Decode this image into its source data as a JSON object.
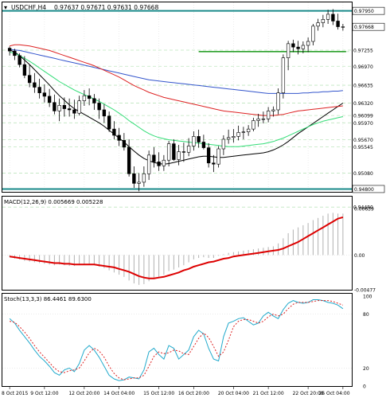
{
  "header": {
    "symbol": "USDCHF,H4",
    "quote": "0.97637 0.97671 0.97631 0.97668"
  },
  "colors": {
    "bull_candle": "#ffffff",
    "bear_candle": "#000000",
    "level_line": "#1a8a8a",
    "support_line": "#2ca02c",
    "ma_black": "#000000",
    "ma_blue": "#3355cc",
    "ma_red": "#dd2222",
    "ma_green": "#33dd77",
    "macd_signal": "#dd0000",
    "macd_hist": "#b0b0b0",
    "stoch_main": "#22aacc",
    "stoch_signal": "#dd2222",
    "grid": "#e0e0e0",
    "dashed_level": "#bfe6bf"
  },
  "chart_data": [
    {
      "type": "candlestick",
      "title": "USDCHF,H4",
      "ylim": [
        0.9475,
        0.981
      ],
      "price_ticks": [
        "0.97950",
        "0.97668",
        "0.97255",
        "0.96970",
        "0.96635",
        "0.96320",
        "0.96099",
        "0.95970",
        "0.95670",
        "0.95545",
        "0.95080",
        "0.94800",
        "0.94480"
      ],
      "highlighted_levels": [
        {
          "label": "0.97950",
          "value": 0.9795
        },
        {
          "label": "0.97668",
          "value": 0.97668
        },
        {
          "label": "0.94800",
          "value": 0.948
        }
      ],
      "support_level": 0.9723,
      "open": [
        0.9729,
        0.9724,
        0.9716,
        0.97,
        0.9681,
        0.9668,
        0.966,
        0.965,
        0.9644,
        0.9633,
        0.9618,
        0.9628,
        0.9622,
        0.962,
        0.9614,
        0.9636,
        0.9645,
        0.964,
        0.9632,
        0.962,
        0.9609,
        0.9586,
        0.9575,
        0.9566,
        0.9554,
        0.9507,
        0.949,
        0.9492,
        0.9507,
        0.954,
        0.9528,
        0.9521,
        0.9531,
        0.956,
        0.9532,
        0.9546,
        0.9545,
        0.9556,
        0.9573,
        0.9563,
        0.9553,
        0.9526,
        0.9524,
        0.9551,
        0.9568,
        0.9571,
        0.9573,
        0.958,
        0.9581,
        0.9586,
        0.9601,
        0.9604,
        0.9604,
        0.9618,
        0.962,
        0.965,
        0.9712,
        0.9737,
        0.9731,
        0.9728,
        0.9734,
        0.9741,
        0.9768,
        0.9774,
        0.978,
        0.9789,
        0.9777,
        0.9767
      ],
      "high": [
        0.9732,
        0.9728,
        0.972,
        0.9715,
        0.97,
        0.9685,
        0.9675,
        0.9665,
        0.9657,
        0.9647,
        0.964,
        0.9642,
        0.964,
        0.9638,
        0.9645,
        0.9655,
        0.9658,
        0.9648,
        0.964,
        0.963,
        0.9617,
        0.96,
        0.9588,
        0.9579,
        0.9568,
        0.952,
        0.9508,
        0.952,
        0.9548,
        0.9554,
        0.9545,
        0.954,
        0.9565,
        0.9568,
        0.9558,
        0.9562,
        0.957,
        0.9582,
        0.9585,
        0.9576,
        0.9561,
        0.954,
        0.9556,
        0.9575,
        0.9585,
        0.9586,
        0.9592,
        0.959,
        0.9593,
        0.9606,
        0.9613,
        0.9617,
        0.9625,
        0.9626,
        0.9658,
        0.9718,
        0.9742,
        0.9744,
        0.9742,
        0.9741,
        0.9748,
        0.9772,
        0.9781,
        0.9788,
        0.9797,
        0.9798,
        0.979,
        0.9772
      ],
      "low": [
        0.9716,
        0.9708,
        0.9695,
        0.9676,
        0.966,
        0.965,
        0.964,
        0.9633,
        0.9625,
        0.9612,
        0.96,
        0.9608,
        0.9608,
        0.9604,
        0.961,
        0.9627,
        0.9628,
        0.962,
        0.9604,
        0.9597,
        0.9581,
        0.9568,
        0.9556,
        0.9548,
        0.9502,
        0.9482,
        0.9476,
        0.9484,
        0.9496,
        0.9518,
        0.9512,
        0.9512,
        0.952,
        0.953,
        0.9522,
        0.9528,
        0.9538,
        0.9548,
        0.9553,
        0.955,
        0.9518,
        0.951,
        0.9518,
        0.954,
        0.956,
        0.9562,
        0.9566,
        0.9568,
        0.9574,
        0.9582,
        0.959,
        0.9596,
        0.9598,
        0.9608,
        0.9612,
        0.964,
        0.969,
        0.9722,
        0.9718,
        0.972,
        0.9722,
        0.9734,
        0.976,
        0.9766,
        0.9772,
        0.977,
        0.9762,
        0.976
      ],
      "close": [
        0.9724,
        0.9716,
        0.97,
        0.9681,
        0.9668,
        0.966,
        0.965,
        0.9644,
        0.9633,
        0.9618,
        0.9628,
        0.9622,
        0.962,
        0.9614,
        0.9636,
        0.9645,
        0.964,
        0.9632,
        0.962,
        0.9609,
        0.9586,
        0.9575,
        0.9566,
        0.9554,
        0.9507,
        0.949,
        0.9492,
        0.9507,
        0.954,
        0.9528,
        0.9521,
        0.9531,
        0.956,
        0.9532,
        0.9546,
        0.9545,
        0.9556,
        0.9573,
        0.9563,
        0.9553,
        0.9526,
        0.9524,
        0.9551,
        0.9568,
        0.9571,
        0.9573,
        0.958,
        0.9581,
        0.9586,
        0.9601,
        0.9604,
        0.9604,
        0.9618,
        0.962,
        0.965,
        0.9712,
        0.9737,
        0.9731,
        0.9728,
        0.9734,
        0.9741,
        0.9768,
        0.9774,
        0.978,
        0.9789,
        0.9777,
        0.9767,
        0.9767
      ],
      "series": [
        {
          "name": "MA black",
          "values": [
            0.9726,
            0.9722,
            0.9716,
            0.9708,
            0.97,
            0.9691,
            0.9682,
            0.9673,
            0.9664,
            0.9654,
            0.9645,
            0.9637,
            0.9629,
            0.9622,
            0.9617,
            0.9612,
            0.9607,
            0.9602,
            0.9597,
            0.9591,
            0.9584,
            0.9577,
            0.957,
            0.9563,
            0.9555,
            0.9547,
            0.954,
            0.9534,
            0.953,
            0.9527,
            0.9525,
            0.9524,
            0.9525,
            0.9527,
            0.9529,
            0.9531,
            0.9533,
            0.9535,
            0.9537,
            0.9538,
            0.9538,
            0.9537,
            0.9536,
            0.9536,
            0.9537,
            0.9538,
            0.9539,
            0.954,
            0.9541,
            0.9542,
            0.9543,
            0.9544,
            0.9546,
            0.9549,
            0.9553,
            0.9558,
            0.9564,
            0.9571,
            0.9578,
            0.9584,
            0.959,
            0.9596,
            0.9602,
            0.9608,
            0.9614,
            0.962,
            0.9626,
            0.9632
          ]
        },
        {
          "name": "MA blue",
          "values": [
            0.9727,
            0.9726,
            0.9725,
            0.9723,
            0.9721,
            0.9719,
            0.9717,
            0.9715,
            0.9713,
            0.9711,
            0.9709,
            0.9707,
            0.9705,
            0.9703,
            0.9701,
            0.9699,
            0.9697,
            0.9695,
            0.9693,
            0.9691,
            0.9689,
            0.9687,
            0.9685,
            0.9683,
            0.9681,
            0.9679,
            0.9677,
            0.9675,
            0.9673,
            0.9672,
            0.9671,
            0.967,
            0.9669,
            0.9668,
            0.9667,
            0.9666,
            0.9665,
            0.9664,
            0.9663,
            0.9662,
            0.9661,
            0.966,
            0.9659,
            0.9658,
            0.9657,
            0.9656,
            0.9655,
            0.9654,
            0.9653,
            0.9652,
            0.9651,
            0.965,
            0.9649,
            0.9649,
            0.9649,
            0.9649,
            0.9649,
            0.9649,
            0.9649,
            0.965,
            0.965,
            0.9651,
            0.9651,
            0.9652,
            0.9652,
            0.9653,
            0.9653,
            0.9654
          ]
        },
        {
          "name": "MA red",
          "values": [
            0.9733,
            0.9735,
            0.9735,
            0.9734,
            0.9733,
            0.9731,
            0.9729,
            0.9727,
            0.9725,
            0.9722,
            0.9719,
            0.9716,
            0.9713,
            0.971,
            0.9707,
            0.9704,
            0.9701,
            0.9698,
            0.9694,
            0.969,
            0.9686,
            0.9682,
            0.9678,
            0.9673,
            0.9668,
            0.9663,
            0.9659,
            0.9655,
            0.9651,
            0.9648,
            0.9645,
            0.9642,
            0.964,
            0.9638,
            0.9636,
            0.9634,
            0.9632,
            0.963,
            0.9628,
            0.9626,
            0.9624,
            0.9622,
            0.962,
            0.9618,
            0.9617,
            0.9616,
            0.9615,
            0.9614,
            0.9613,
            0.9612,
            0.9611,
            0.961,
            0.961,
            0.961,
            0.9611,
            0.9612,
            0.9614,
            0.9616,
            0.9618,
            0.9619,
            0.962,
            0.9621,
            0.9622,
            0.9623,
            0.9624,
            0.9625,
            0.9626,
            0.9627
          ]
        },
        {
          "name": "MA green",
          "values": [
            0.9722,
            0.972,
            0.9716,
            0.9711,
            0.9706,
            0.97,
            0.9694,
            0.9688,
            0.9682,
            0.9676,
            0.967,
            0.9665,
            0.966,
            0.9655,
            0.9651,
            0.9647,
            0.9643,
            0.9639,
            0.9635,
            0.963,
            0.9625,
            0.962,
            0.9614,
            0.9608,
            0.9601,
            0.9595,
            0.9589,
            0.9583,
            0.9578,
            0.9574,
            0.9571,
            0.9569,
            0.9567,
            0.9566,
            0.9565,
            0.9564,
            0.9563,
            0.9562,
            0.9561,
            0.956,
            0.9559,
            0.9558,
            0.9557,
            0.9556,
            0.9555,
            0.9555,
            0.9555,
            0.9556,
            0.9557,
            0.9558,
            0.9559,
            0.956,
            0.9562,
            0.9564,
            0.9567,
            0.957,
            0.9574,
            0.9578,
            0.9582,
            0.9586,
            0.959,
            0.9594,
            0.9597,
            0.96,
            0.9602,
            0.9604,
            0.9606,
            0.9608
          ]
        }
      ]
    },
    {
      "type": "histogram-line",
      "title": "MACD(12,26,9) 0.005669 0.005228",
      "ylim": [
        -0.00477,
        0.00639
      ],
      "ticks": [
        "0.00639",
        "0.00",
        "-0.00477"
      ],
      "hist": [
        -0.0003,
        -0.0005,
        -0.0006,
        -0.0008,
        -0.0009,
        -0.001,
        -0.0011,
        -0.0012,
        -0.0013,
        -0.0014,
        -0.0013,
        -0.0014,
        -0.0015,
        -0.0015,
        -0.0014,
        -0.0013,
        -0.0013,
        -0.0014,
        -0.0016,
        -0.0018,
        -0.0021,
        -0.0024,
        -0.0027,
        -0.003,
        -0.0035,
        -0.0039,
        -0.0041,
        -0.004,
        -0.0036,
        -0.0033,
        -0.003,
        -0.0027,
        -0.0022,
        -0.002,
        -0.0017,
        -0.0014,
        -0.001,
        -0.0006,
        -0.0004,
        -0.0003,
        -0.0004,
        -0.0004,
        -0.0001,
        0.0001,
        0.0003,
        0.0004,
        0.0005,
        0.0006,
        0.0007,
        0.0008,
        0.0009,
        0.001,
        0.0011,
        0.0012,
        0.0016,
        0.0023,
        0.003,
        0.0035,
        0.0038,
        0.0041,
        0.0044,
        0.0048,
        0.0051,
        0.0054,
        0.0057,
        0.0058,
        0.0057,
        0.0057
      ],
      "signal": [
        -0.0002,
        -0.0003,
        -0.0004,
        -0.0005,
        -0.0006,
        -0.0007,
        -0.0008,
        -0.0009,
        -0.001,
        -0.0011,
        -0.0011,
        -0.0012,
        -0.0012,
        -0.0013,
        -0.0013,
        -0.0013,
        -0.0013,
        -0.0013,
        -0.0014,
        -0.0015,
        -0.0016,
        -0.0017,
        -0.0019,
        -0.0021,
        -0.0023,
        -0.0026,
        -0.0029,
        -0.0031,
        -0.0032,
        -0.0032,
        -0.0031,
        -0.003,
        -0.0028,
        -0.0026,
        -0.0024,
        -0.0021,
        -0.0019,
        -0.0016,
        -0.0014,
        -0.0012,
        -0.001,
        -0.0009,
        -0.0007,
        -0.0005,
        -0.0004,
        -0.0002,
        -0.0001,
        0.0,
        0.0001,
        0.0002,
        0.0003,
        0.0004,
        0.0005,
        0.0006,
        0.0007,
        0.0009,
        0.0012,
        0.0015,
        0.0018,
        0.0022,
        0.0026,
        0.003,
        0.0034,
        0.0038,
        0.0042,
        0.0046,
        0.005,
        0.0052
      ]
    },
    {
      "type": "line",
      "title": "Stoch(13,3,3) 86.4461 89.6300",
      "ylim": [
        0,
        100
      ],
      "ticks": [
        "100",
        "80",
        "20",
        "0"
      ],
      "main": [
        75,
        70,
        62,
        55,
        48,
        40,
        33,
        28,
        22,
        15,
        12,
        18,
        20,
        16,
        25,
        40,
        45,
        40,
        32,
        22,
        12,
        8,
        6,
        7,
        10,
        9,
        8,
        18,
        38,
        42,
        35,
        30,
        45,
        42,
        30,
        35,
        40,
        55,
        62,
        58,
        42,
        30,
        28,
        55,
        70,
        72,
        75,
        76,
        72,
        68,
        70,
        78,
        82,
        78,
        75,
        85,
        92,
        95,
        93,
        92,
        93,
        96,
        96,
        95,
        93,
        92,
        90,
        86
      ],
      "signal": [
        72,
        71,
        66,
        60,
        53,
        45,
        38,
        32,
        26,
        20,
        16,
        15,
        17,
        18,
        20,
        28,
        37,
        42,
        39,
        32,
        22,
        14,
        9,
        7,
        8,
        9,
        9,
        12,
        22,
        33,
        38,
        36,
        37,
        40,
        39,
        36,
        35,
        44,
        53,
        59,
        54,
        44,
        33,
        38,
        51,
        66,
        72,
        74,
        74,
        72,
        70,
        72,
        77,
        80,
        78,
        80,
        86,
        91,
        93,
        93,
        93,
        94,
        95,
        95,
        95,
        94,
        92,
        90
      ]
    }
  ],
  "time_axis": {
    "labels": [
      "8 Oct 2015",
      "9 Oct 12:00",
      "12 Oct 20:00",
      "14 Oct 04:00",
      "15 Oct 12:00",
      "16 Oct 20:00",
      "20 Oct 04:00",
      "21 Oct 12:00",
      "22 Oct 20:00",
      "26 Oct 04:00"
    ]
  },
  "price_axis": {
    "labels": [
      "0.97950",
      "0.97668",
      "0.97255",
      "0.96970",
      "0.96635",
      "0.96320",
      "0.96099",
      "0.95970",
      "0.95670",
      "0.95545",
      "0.95080",
      "0.94800",
      "0.94480"
    ]
  }
}
